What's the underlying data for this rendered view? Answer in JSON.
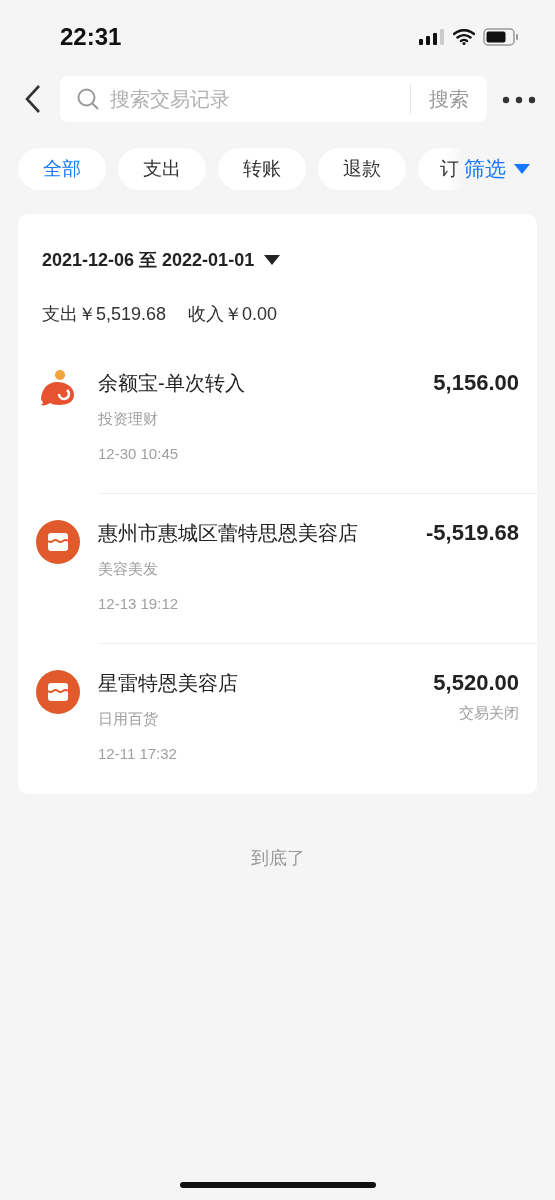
{
  "status_bar": {
    "time": "22:31"
  },
  "header": {
    "search": {
      "placeholder": "搜索交易记录"
    },
    "search_button": "搜索"
  },
  "chips": [
    {
      "label": "全部",
      "selected": true
    },
    {
      "label": "支出",
      "selected": false
    },
    {
      "label": "转账",
      "selected": false
    },
    {
      "label": "退款",
      "selected": false
    },
    {
      "label": "订",
      "selected": false
    }
  ],
  "filter": "筛选",
  "period": {
    "range": "2021-12-06 至 2022-01-01",
    "expense": "支出￥5,519.68",
    "income": "收入￥0.00"
  },
  "transactions": [
    {
      "kind": "fish",
      "title": "余额宝-单次转入",
      "category": "投资理财",
      "time": "12-30 10:45",
      "amount": "5,156.00"
    },
    {
      "kind": "shop",
      "title": "惠州市惠城区蕾特思恩美容店",
      "category": "美容美发",
      "time": "12-13 19:12",
      "amount": "-5,519.68"
    },
    {
      "kind": "shop",
      "title": "星雷特恩美容店",
      "category": "日用百货",
      "time": "12-11 17:32",
      "amount": "5,520.00",
      "status": "交易关闭"
    }
  ],
  "end_note": "到底了"
}
